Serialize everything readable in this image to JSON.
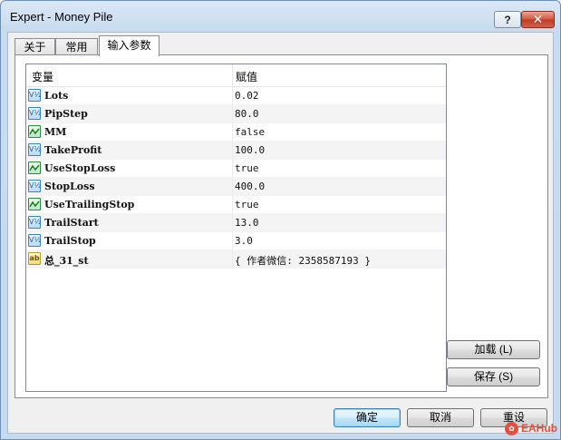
{
  "window": {
    "title": "Expert - Money Pile",
    "help_label": "?",
    "close_label": "✕"
  },
  "tabs": [
    {
      "label": "关于"
    },
    {
      "label": "常用"
    },
    {
      "label": "输入参数"
    }
  ],
  "grid": {
    "columns": [
      "变量",
      "赋值"
    ],
    "rows": [
      {
        "icon": "numeric-variable-icon",
        "name": "Lots",
        "value": "0.02"
      },
      {
        "icon": "numeric-variable-icon",
        "name": "PipStep",
        "value": "80.0"
      },
      {
        "icon": "boolean-variable-icon",
        "name": "MM",
        "value": "false"
      },
      {
        "icon": "numeric-variable-icon",
        "name": "TakeProfit",
        "value": "100.0"
      },
      {
        "icon": "boolean-variable-icon",
        "name": "UseStopLoss",
        "value": "true"
      },
      {
        "icon": "numeric-variable-icon",
        "name": "StopLoss",
        "value": "400.0"
      },
      {
        "icon": "boolean-variable-icon",
        "name": "UseTrailingStop",
        "value": "true"
      },
      {
        "icon": "numeric-variable-icon",
        "name": "TrailStart",
        "value": "13.0"
      },
      {
        "icon": "numeric-variable-icon",
        "name": "TrailStop",
        "value": "3.0"
      },
      {
        "icon": "string-variable-icon",
        "name": "总_31_st",
        "value": "{ 作者微信: 2358587193 }"
      }
    ]
  },
  "side_buttons": {
    "load": "加载 (L)",
    "save": "保存 (S)"
  },
  "footer": {
    "ok": "确定",
    "cancel": "取消",
    "reset": "重设"
  },
  "watermark": {
    "text": "EAHub"
  },
  "colors": {
    "title_bar": "#c9dcef",
    "close_button": "#c13a22",
    "default_button_border": "#3c7fb1"
  }
}
